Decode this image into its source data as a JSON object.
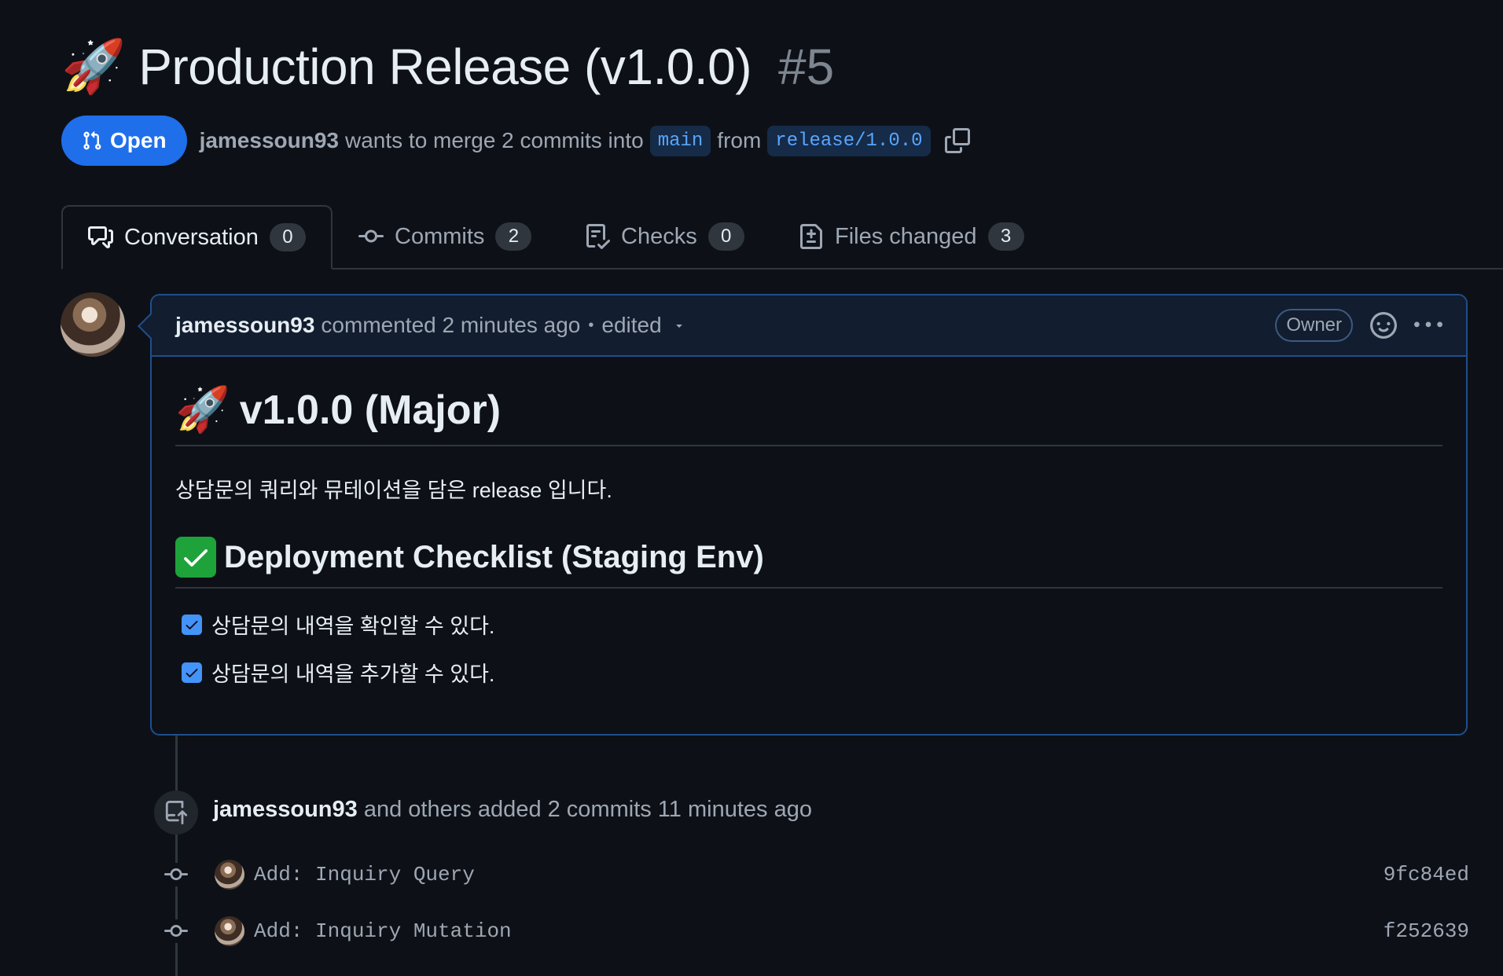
{
  "pr": {
    "title_emoji": "🚀",
    "title": "Production Release (v1.0.0)",
    "number": "#5",
    "state": "Open",
    "author": "jamessoun93",
    "merge_text": "wants to merge 2 commits into",
    "base_branch": "main",
    "from_text": "from",
    "head_branch": "release/1.0.0"
  },
  "tabs": [
    {
      "label": "Conversation",
      "count": "0"
    },
    {
      "label": "Commits",
      "count": "2"
    },
    {
      "label": "Checks",
      "count": "0"
    },
    {
      "label": "Files changed",
      "count": "3"
    }
  ],
  "comment": {
    "author": "jamessoun93",
    "meta": "commented 2 minutes ago",
    "separator": "•",
    "edited": "edited",
    "role_badge": "Owner",
    "heading_emoji": "🚀",
    "heading": "v1.0.0 (Major)",
    "description": "상담문의 쿼리와 뮤테이션을 담은 release 입니다.",
    "checklist_heading": "Deployment Checklist (Staging Env)",
    "tasks": [
      {
        "label": "상담문의 내역을 확인할 수 있다.",
        "checked": true
      },
      {
        "label": "상담문의 내역을 추가할 수 있다.",
        "checked": true
      }
    ]
  },
  "timeline": {
    "actor": "jamessoun93",
    "event_text": "and others added 2 commits 11 minutes ago",
    "commits": [
      {
        "message": "Add: Inquiry Query",
        "sha": "9fc84ed"
      },
      {
        "message": "Add: Inquiry Mutation",
        "sha": "f252639"
      }
    ]
  },
  "colors": {
    "background": "#0d1117",
    "accent": "#1f6feb",
    "link": "#58a6ff",
    "muted": "#9ea7b3",
    "check_green": "#1ea23a"
  },
  "icons": [
    "rocket-icon",
    "git-pull-request-icon",
    "copy-icon",
    "comment-discussion-icon",
    "git-commit-icon",
    "checklist-icon",
    "file-diff-icon",
    "smiley-icon",
    "kebab-horizontal-icon",
    "triangle-down-icon",
    "check-icon",
    "repo-push-icon"
  ]
}
